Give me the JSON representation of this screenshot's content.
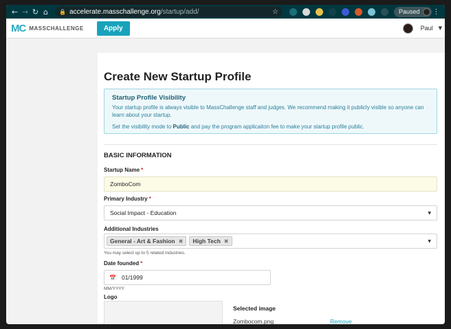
{
  "browser": {
    "url_host": "accelerate.masschallenge.org",
    "url_path": "/startup/add/",
    "profile_status": "Paused"
  },
  "header": {
    "logo_mark": "MC",
    "logo_text": "MASSCHALLENGE",
    "apply_label": "Apply",
    "user_name": "Paul"
  },
  "page": {
    "title": "Create New Startup Profile",
    "notice": {
      "title": "Startup Profile Visibility",
      "line1": "Your startup profile is always visible to MassChallenge staff and judges. We recommend making it publicly visible so anyone can learn about your startup.",
      "line2_prefix": "Set the visibility mode to ",
      "line2_bold": "Public",
      "line2_suffix": " and pay the program applicaiton fee to make your startup profile public."
    },
    "section_title": "BASIC INFORMATION",
    "startup_name": {
      "label": "Startup Name",
      "value": "ZomboCom"
    },
    "primary_industry": {
      "label": "Primary Industry",
      "value": "Social Impact - Education"
    },
    "additional_industries": {
      "label": "Additional Industries",
      "tags": [
        "General - Art & Fashion",
        "High Tech"
      ],
      "hint": "You may select up to 5 related industries."
    },
    "date_founded": {
      "label": "Date founded",
      "value": "01/1999",
      "hint": "MM/YYYY"
    },
    "logo": {
      "label": "Logo",
      "selected_title": "Selected image",
      "file_name": "Zombocom.png",
      "remove_label": "Remove"
    }
  },
  "icons": {
    "required_marker": "*",
    "tag_remove": "✖",
    "dropdown": "▼",
    "calendar": "📅"
  },
  "colors": {
    "chrome": "#00383f",
    "accent": "#18a3bb",
    "notice_bg": "#eef8fb",
    "required": "#d62b2b"
  }
}
